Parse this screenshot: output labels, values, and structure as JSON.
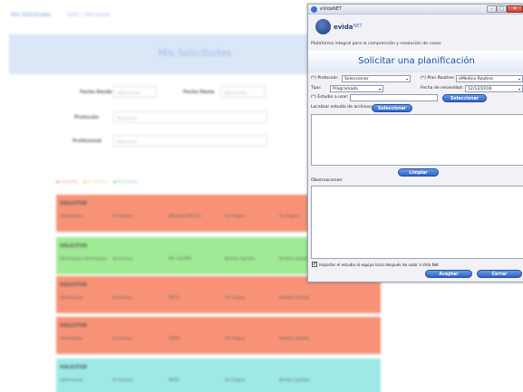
{
  "background_page": {
    "nav": {
      "item1": "Mis Solicitudes",
      "item2": "Salir / Mensajes"
    },
    "banner_title": "Mis Solicitudes",
    "form": {
      "desde_label": "Fecha Desde",
      "desde_value": "dd/mm/aaaa",
      "hasta_label": "Fecha Hasta",
      "hasta_value": "dd/mm/aaaa",
      "protocolo_label": "Protocolo",
      "protocolo_value": "Seleccione",
      "profesional_label": "Profesional",
      "profesional_value": "Seleccione"
    },
    "legend": [
      "● Aceptada",
      "● En proceso",
      "● Rechazada"
    ],
    "cards": [
      {
        "color": "#f6805f",
        "head": "SOLICITUD",
        "cells": [
          "dd/mm/aaaa",
          "Sin Evaluar",
          "MOLLAR GRACE S.",
          "Sin Asignar",
          "Sin Asignar"
        ]
      },
      {
        "color": "#8fe782",
        "head": "SOLICITUD",
        "cells": [
          "dd/mm/aaaa dd/mm/aaaa",
          "Sin Evaluar",
          "PM. CELIRRA",
          "Nombre Apellido",
          "Nombre Apellido"
        ]
      },
      {
        "color": "#f6805f",
        "head": "SOLICITUD",
        "cells": [
          "dd/mm/aaaa",
          "Sin Evaluar",
          "MACH",
          "Sin Asignar",
          "Nombre Apellido"
        ]
      },
      {
        "color": "#f6805f",
        "head": "SOLICITUD",
        "cells": [
          "dd/mm/aaaa",
          "Sin Evaluar",
          "LOPEZ",
          "Sin Asignar",
          "Nombre Apellido"
        ]
      },
      {
        "color": "#8ce6e2",
        "head": "SOLICITUD",
        "cells": [
          "dd/mm/aaaa",
          "Sin Evaluar",
          "MACH",
          "Sin Asignar",
          "Nombre Apellido"
        ]
      }
    ]
  },
  "dialog": {
    "window_title": "eVidaNET",
    "logo": {
      "brand": "evida",
      "suffix": "NET"
    },
    "tagline": "Plataforma integral para la comprensión y resolución de casos",
    "heading": "Solicitar una planificación",
    "fields": {
      "protocolo_label": "(*) Protocolo:",
      "protocolo_value": "Seleccionar",
      "plan_label": "(*) Plan Routine:",
      "plan_value": "eMedico Routine",
      "tipo_label": "Tipo:",
      "tipo_value": "Programado",
      "fecha_label": "Fecha de necesidad:",
      "fecha_value": "12/12/2016",
      "estudio_label": "(*) Estudio a usar:",
      "estudio_value": "",
      "seleccionar_label": "Seleccionar",
      "localizar_label": "Localizar estudio de archivos:",
      "seleccionar2_label": "Seleccionar"
    },
    "limpiar_label": "Limpiar",
    "observaciones_label": "Observaciones:",
    "checkbox_label": "Importar el estudio al equipo local después de subir a Vida Net",
    "checkbox_checked": "✔",
    "aceptar_label": "Aceptar",
    "cerrar_label": "Cerrar",
    "min_symbol": "–",
    "max_symbol": "□",
    "close_symbol": "✕",
    "arrow_symbol": "▾"
  }
}
